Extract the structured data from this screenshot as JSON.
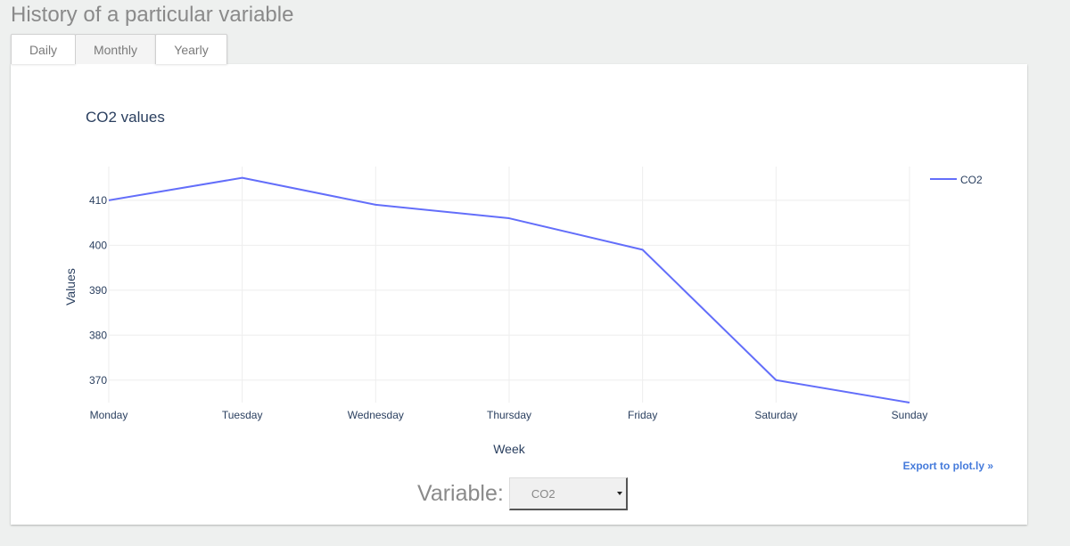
{
  "page": {
    "title": "History of a particular variable"
  },
  "tabs": [
    {
      "label": "Daily"
    },
    {
      "label": "Monthly",
      "active": true
    },
    {
      "label": "Yearly"
    }
  ],
  "export_link": "Export to plot.ly »",
  "variable": {
    "label": "Variable:",
    "selected": "CO2"
  },
  "colors": {
    "line": "#636efa",
    "text": "#2a3f5f",
    "grid": "#eeeeee"
  },
  "chart_data": {
    "type": "line",
    "title": "CO2 values",
    "xlabel": "Week",
    "ylabel": "Values",
    "categories": [
      "Monday",
      "Tuesday",
      "Wednesday",
      "Thursday",
      "Friday",
      "Saturday",
      "Sunday"
    ],
    "series": [
      {
        "name": "CO2",
        "values": [
          410,
          415,
          409,
          406,
          399,
          370,
          365
        ]
      }
    ],
    "yticks": [
      370,
      380,
      390,
      400,
      410
    ],
    "ylim": [
      365,
      417.5
    ],
    "grid": true,
    "legend": "top-right"
  }
}
